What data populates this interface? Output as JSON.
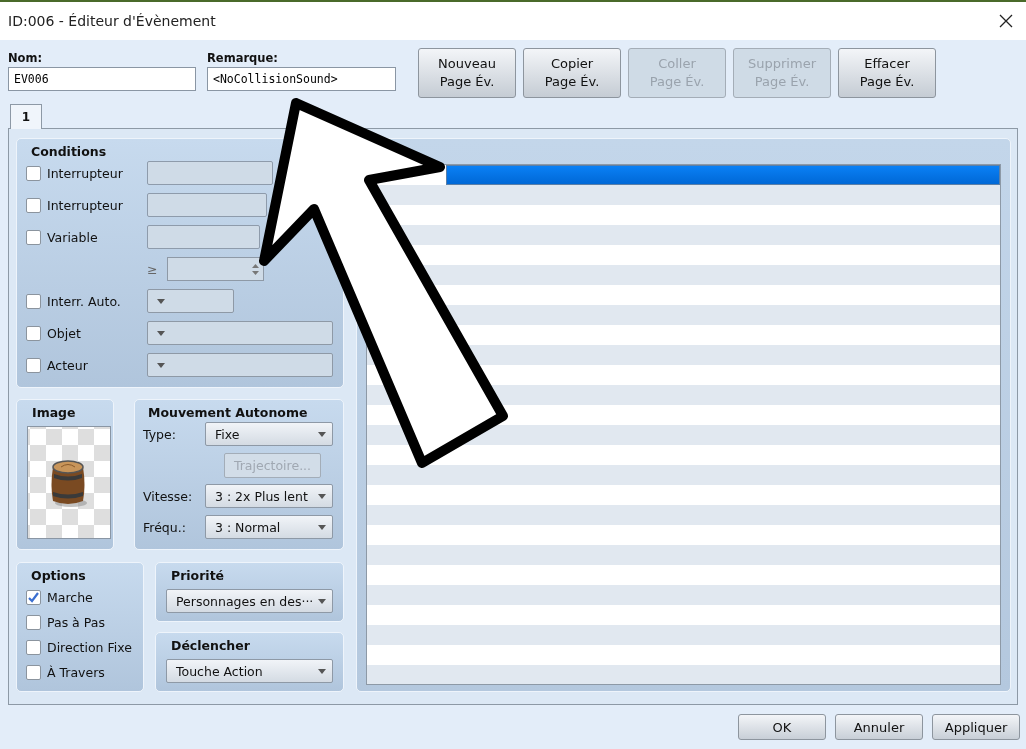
{
  "window": {
    "title": "ID:006 - Éditeur d'Évènement"
  },
  "name_field": {
    "label": "Nom:",
    "value": "EV006"
  },
  "note_field": {
    "label": "Remarque:",
    "value": "<NoCollisionSound>"
  },
  "page_buttons": [
    {
      "label": "Nouveau\nPage Év.",
      "disabled": false
    },
    {
      "label": "Copier\nPage Év.",
      "disabled": false
    },
    {
      "label": "Coller\nPage Év.",
      "disabled": true
    },
    {
      "label": "Supprimer\nPage Év.",
      "disabled": true
    },
    {
      "label": "Effacer\nPage Év.",
      "disabled": false
    }
  ],
  "tabs": [
    {
      "label": "1",
      "selected": true
    }
  ],
  "conditions": {
    "title": "Conditions",
    "rows": [
      {
        "kind": "checkfield",
        "label": "Interrupteur",
        "checked": false
      },
      {
        "kind": "checkfield",
        "label": "Interrupteur",
        "checked": false
      },
      {
        "kind": "checkfield",
        "label": "Variable",
        "checked": false
      },
      {
        "kind": "compare",
        "symbol": "≥"
      },
      {
        "kind": "checkshortlist",
        "label": "Interr. Auto.",
        "checked": false
      },
      {
        "kind": "checklist",
        "label": "Objet",
        "checked": false
      },
      {
        "kind": "checklist",
        "label": "Acteur",
        "checked": false
      }
    ]
  },
  "image": {
    "title": "Image"
  },
  "movement": {
    "title": "Mouvement Autonome",
    "rows": [
      {
        "kind": "select",
        "label": "Type:",
        "value": "Fixe"
      },
      {
        "kind": "button",
        "label": "Trajectoire...",
        "disabled": true
      },
      {
        "kind": "select",
        "label": "Vitesse:",
        "value": "3 : 2x Plus lent"
      },
      {
        "kind": "select",
        "label": "Fréqu.:",
        "value": "3 : Normal"
      }
    ]
  },
  "options": {
    "title": "Options",
    "items": [
      {
        "label": "Marche",
        "checked": true
      },
      {
        "label": "Pas à Pas",
        "checked": false
      },
      {
        "label": "Direction Fixe",
        "checked": false
      },
      {
        "label": "À Travers",
        "checked": false
      }
    ]
  },
  "priority": {
    "title": "Priorité",
    "value": "Personnages en des···"
  },
  "trigger": {
    "title": "Déclencher",
    "value": "Touche Action"
  },
  "contents": {
    "rows": [
      {
        "selected": true
      }
    ]
  },
  "footer_buttons": [
    "OK",
    "Annuler",
    "Appliquer"
  ]
}
